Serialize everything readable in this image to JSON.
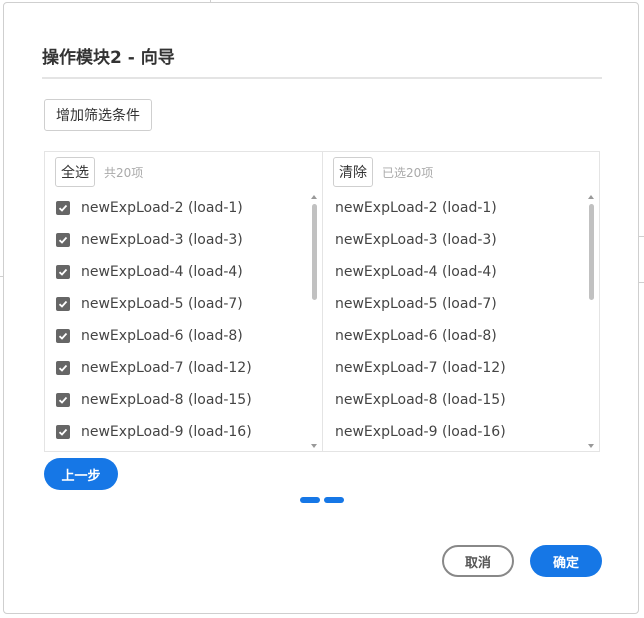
{
  "dialog": {
    "title": "操作模块2 - 向导",
    "add_filter_label": "增加筛选条件"
  },
  "left_panel": {
    "select_all_label": "全选",
    "count_text": "共20项",
    "items": [
      {
        "label": "newExpLoad-2 (load-1)",
        "checked": true
      },
      {
        "label": "newExpLoad-3 (load-3)",
        "checked": true
      },
      {
        "label": "newExpLoad-4 (load-4)",
        "checked": true
      },
      {
        "label": "newExpLoad-5 (load-7)",
        "checked": true
      },
      {
        "label": "newExpLoad-6 (load-8)",
        "checked": true
      },
      {
        "label": "newExpLoad-7 (load-12)",
        "checked": true
      },
      {
        "label": "newExpLoad-8 (load-15)",
        "checked": true
      },
      {
        "label": "newExpLoad-9 (load-16)",
        "checked": true
      }
    ]
  },
  "right_panel": {
    "clear_label": "清除",
    "count_text": "已选20项",
    "items": [
      {
        "label": "newExpLoad-2 (load-1)"
      },
      {
        "label": "newExpLoad-3 (load-3)"
      },
      {
        "label": "newExpLoad-4 (load-4)"
      },
      {
        "label": "newExpLoad-5 (load-7)"
      },
      {
        "label": "newExpLoad-6 (load-8)"
      },
      {
        "label": "newExpLoad-7 (load-12)"
      },
      {
        "label": "newExpLoad-8 (load-15)"
      },
      {
        "label": "newExpLoad-9 (load-16)"
      }
    ]
  },
  "footer": {
    "prev_label": "上一步",
    "cancel_label": "取消",
    "ok_label": "确定",
    "steps_total": 2
  },
  "colors": {
    "accent": "#1677e6",
    "checkbox": "#666666",
    "muted_text": "#aaaaaa"
  }
}
